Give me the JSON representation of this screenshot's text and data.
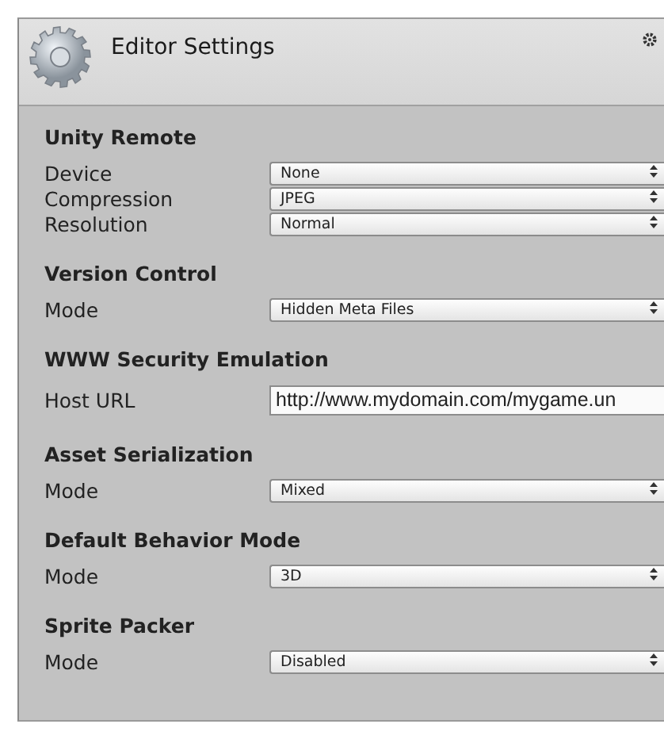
{
  "window": {
    "title": "Editor Settings"
  },
  "sections": [
    {
      "title": "Unity Remote",
      "rows": [
        {
          "label": "Device",
          "kind": "dropdown",
          "value": "None"
        },
        {
          "label": "Compression",
          "kind": "dropdown",
          "value": "JPEG"
        },
        {
          "label": "Resolution",
          "kind": "dropdown",
          "value": "Normal"
        }
      ]
    },
    {
      "title": "Version Control",
      "rows": [
        {
          "label": "Mode",
          "kind": "dropdown",
          "value": "Hidden Meta Files"
        }
      ]
    },
    {
      "title": "WWW Security Emulation",
      "rows": [
        {
          "label": "Host URL",
          "kind": "textfield",
          "value": "http://www.mydomain.com/mygame.un"
        }
      ]
    },
    {
      "title": "Asset Serialization",
      "rows": [
        {
          "label": "Mode",
          "kind": "dropdown",
          "value": "Mixed"
        }
      ]
    },
    {
      "title": "Default Behavior Mode",
      "rows": [
        {
          "label": "Mode",
          "kind": "dropdown",
          "value": "3D"
        }
      ]
    },
    {
      "title": "Sprite Packer",
      "rows": [
        {
          "label": "Mode",
          "kind": "dropdown",
          "value": "Disabled"
        }
      ]
    }
  ]
}
